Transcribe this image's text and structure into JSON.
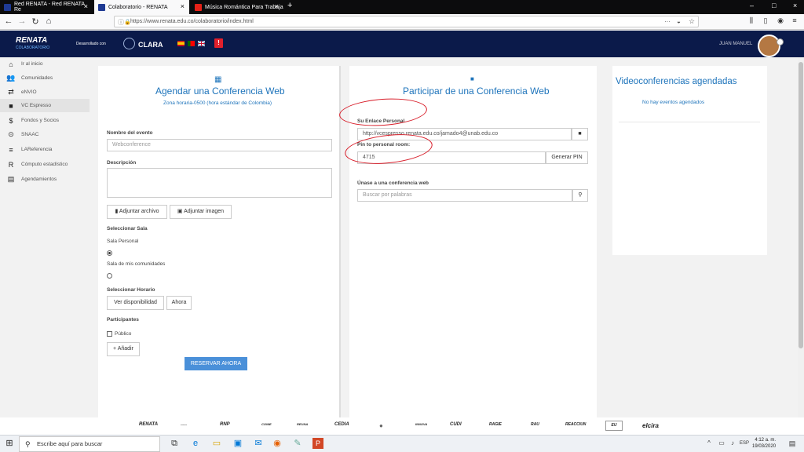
{
  "browser": {
    "tabs": [
      {
        "label": "Red RENATA - Red RENATA Re",
        "color": "#1f3a93"
      },
      {
        "label": "Colaboratorio - RENATA",
        "color": "#1f3a93"
      },
      {
        "label": "Música Romántica Para Trabaja",
        "color": "#e62117"
      }
    ],
    "url": "https://www.renata.edu.co/colaboratorio/index.html",
    "new_tab": "+",
    "close": "×",
    "minimize": "–",
    "maximize": "□",
    "window_close": "×"
  },
  "header": {
    "logo": "RENATA",
    "logo_sub": "COLABORATORIO",
    "developed_by": "Desarrollado con",
    "partner": "CLARA",
    "alert": "!",
    "user_name": "JUAN MANUEL"
  },
  "sidebar": {
    "items": [
      {
        "label": "Ir al inicio",
        "icon": "⌂"
      },
      {
        "label": "Comunidades",
        "icon": "👥"
      },
      {
        "label": "eNVIO",
        "icon": "⇄"
      },
      {
        "label": "VC Espresso",
        "icon": "■"
      },
      {
        "label": "Fondos y Socios",
        "icon": "$"
      },
      {
        "label": "SNAAC",
        "icon": "⊙"
      },
      {
        "label": "LAReferencia",
        "icon": "≡"
      },
      {
        "label": "Cómputo estadístico",
        "icon": "R"
      },
      {
        "label": "Agendamientos",
        "icon": "▤"
      }
    ]
  },
  "schedule": {
    "icon": "▦",
    "title": "Agendar una Conferencia Web",
    "timezone": "Zona horaria-0500 (hora estándar de Colombia)",
    "event_label": "Nombre del evento",
    "event_placeholder": "Webconference",
    "description_label": "Descripción",
    "attach_file": "Adjuntar archivo",
    "attach_image": "Adjuntar imagen",
    "room_label": "Seleccionar Sala",
    "room_personal": "Sala Personal",
    "room_communities": "Sala de mis comunidades",
    "time_label": "Seleccionar Horario",
    "availability": "Ver disponibilidad",
    "now": "Ahora",
    "participants_label": "Participantes",
    "public": "Público",
    "add": "+ Añadir",
    "reserve": "RESERVAR AHORA"
  },
  "participate": {
    "icon": "■",
    "title": "Participar de una Conferencia Web",
    "link_label": "Su Enlace Personal",
    "link_value": "http://vcespresso.renata.edu.co/jamado4@unab.edu.co",
    "pin_label": "Pin to personal room:",
    "pin_value": "4715",
    "generate_pin": "Generar PIN",
    "join_label": "Únase a una conferencia web",
    "search_placeholder": "Buscar por palabras"
  },
  "scheduled": {
    "title": "Videoconferencias agendadas",
    "empty": "No hay eventos agendados"
  },
  "footer": {
    "logos": [
      "RENATA",
      "------",
      "RNP",
      "CONIE",
      "REUNA",
      "CEDIA",
      "●",
      "INNOVA",
      "CUDI",
      "RAGIE",
      "RAU",
      "REACCIUN",
      "EU",
      "elcira"
    ]
  },
  "taskbar": {
    "search_placeholder": "Escribe aquí para buscar",
    "lang": "ESP",
    "time": "4:12 a. m.",
    "date": "19/03/2020"
  }
}
